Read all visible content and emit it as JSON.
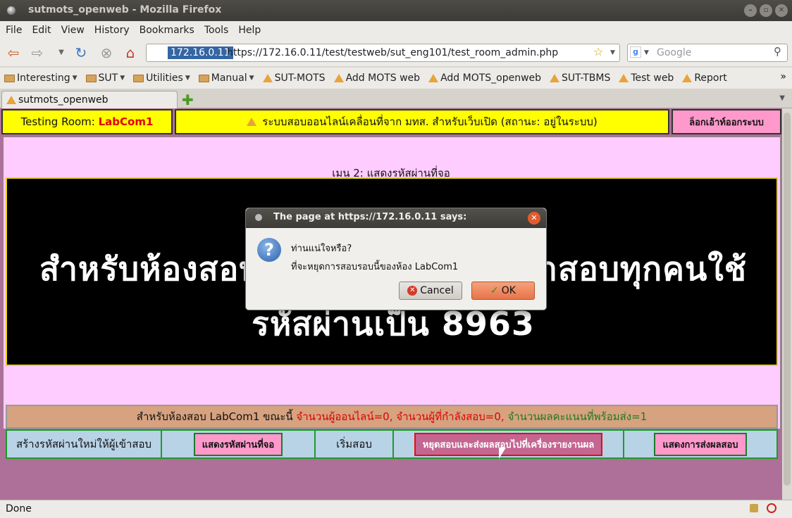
{
  "window": {
    "title": "sutmots_openweb - Mozilla Firefox",
    "minimize": "–",
    "maximize": "▫",
    "close": "✕"
  },
  "menubar": [
    "File",
    "Edit",
    "View",
    "History",
    "Bookmarks",
    "Tools",
    "Help"
  ],
  "navbar": {
    "url_host": "172.16.0.11",
    "url": "https://172.16.0.11/test/testweb/sut_eng101/test_room_admin.php",
    "search_placeholder": "Google"
  },
  "bookmarks": {
    "folders": [
      "Interesting",
      "SUT",
      "Utilities",
      "Manual"
    ],
    "links": [
      "SUT-MOTS",
      "Add MOTS web",
      "Add MOTS_openweb",
      "SUT-TBMS",
      "Test web",
      "Report"
    ]
  },
  "tab": {
    "label": "sutmots_openweb"
  },
  "page": {
    "testing_room_label": "Testing  Room:",
    "room_name": "LabCom1",
    "system_title": "ระบบสอบออนไลน์เคลื่อนที่จาก มทส. สำหรับเว็บเปิด (สถานะ: อยู่ในระบบ)",
    "logout": "ล็อกเอ้าท์ออกระบบ",
    "menu_title": "เมนู 2:  แสดงรหัสผ่านที่จอ",
    "big_line1_left": "สำหรับห้องสอบ",
    "big_line1_right": "ๆาสอบทุกคนใช้",
    "big_line2": "รหัสผ่านเป็น  8963",
    "status_prefix": "สำหรับห้องสอบ  LabCom1  ขณะนี้",
    "status_online": "จำนวนผู้ออนไลน์=0,",
    "status_testing": "จำนวนผู้ที่กำลังสอบ=0,",
    "status_ready": "จำนวนผลคะแนนที่พร้อมส่ง=1",
    "actions": {
      "create_password": "สร้างรหัสผ่านใหม่ให้ผู้เข้าสอบ",
      "show_password": "แสดงรหัสผ่านที่จอ",
      "start_test": "เริ่มสอบ",
      "stop_and_send": "หยุดสอบและส่งผลสอบไปที่เครื่องรายงานผล",
      "show_send_results": "แสดงการส่งผลสอบ"
    }
  },
  "dialog": {
    "title": "The page at https://172.16.0.11 says:",
    "line1": "ท่านแน่ใจหรือ?",
    "line2": "ที่จะหยุดการสอบรอบนี้ของห้อง LabCom1",
    "cancel": "Cancel",
    "ok": "OK"
  },
  "statusbar": {
    "text": "Done"
  }
}
